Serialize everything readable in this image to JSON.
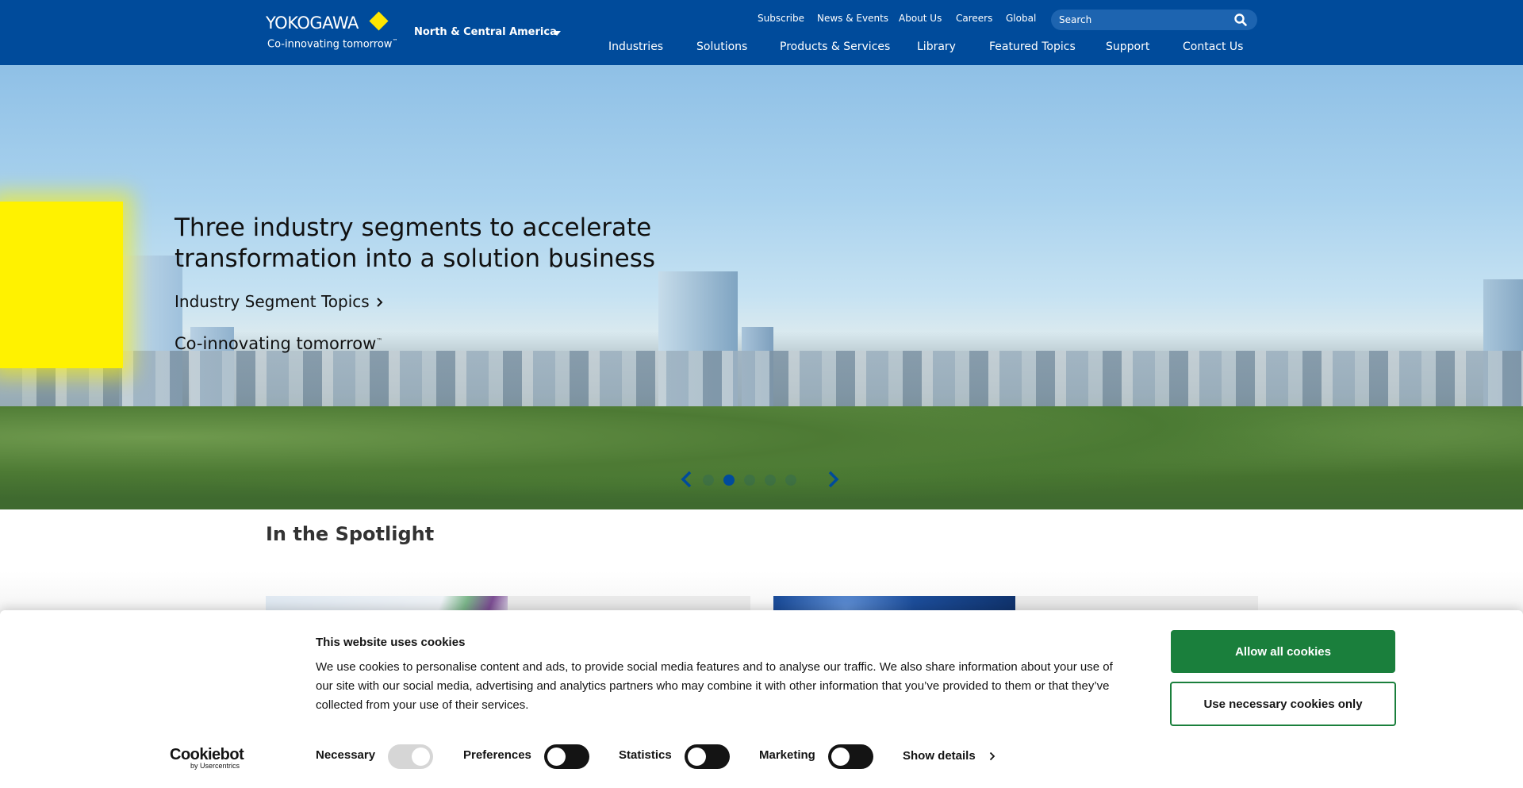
{
  "header": {
    "logo_text": "YOKOGAWA",
    "logo_tagline": "Co-innovating tomorrow",
    "logo_tm": "™",
    "region": "North & Central America",
    "utility_nav": [
      "Subscribe",
      "News & Events",
      "About Us",
      "Careers",
      "Global"
    ],
    "search_placeholder": "Search",
    "main_nav": [
      "Industries",
      "Solutions",
      "Products & Services",
      "Library",
      "Featured Topics",
      "Support",
      "Contact Us"
    ]
  },
  "hero": {
    "title": "Three industry segments to accelerate transformation into a solution business",
    "link_label": "Industry Segment Topics",
    "tagline": "Co-innovating tomorrow",
    "tagline_tm": "™",
    "carousel": {
      "slide_count": 5,
      "active_slide": 2
    }
  },
  "spotlight": {
    "title": "In the Spotlight"
  },
  "cookie_banner": {
    "title": "This website uses cookies",
    "body": "We use cookies to personalise content and ads, to provide social media features and to analyse our traffic. We also share information about your use of our site with our social media, advertising and analytics partners who may combine it with other information that you’ve provided to them or that they’ve collected from your use of their services.",
    "allow_all": "Allow all cookies",
    "necessary_only": "Use necessary cookies only",
    "categories": {
      "necessary": {
        "label": "Necessary",
        "checked": true,
        "disabled": true
      },
      "preferences": {
        "label": "Preferences",
        "checked": false
      },
      "statistics": {
        "label": "Statistics",
        "checked": false
      },
      "marketing": {
        "label": "Marketing",
        "checked": false
      }
    },
    "show_details": "Show details",
    "brand": "Cookiebot",
    "brand_sub": "by Usercentrics"
  },
  "colors": {
    "header_blue": "#004b9b",
    "brand_yellow": "#ffe600",
    "accept_green": "#1a7f3c",
    "carousel_blue": "#004b9b"
  },
  "icons": {
    "search": "search-icon",
    "region_caret": "chevron-down-icon",
    "hero_link": "chevron-right-icon",
    "carousel_prev": "chevron-left-icon",
    "carousel_next": "chevron-right-icon",
    "show_details": "chevron-right-icon"
  }
}
